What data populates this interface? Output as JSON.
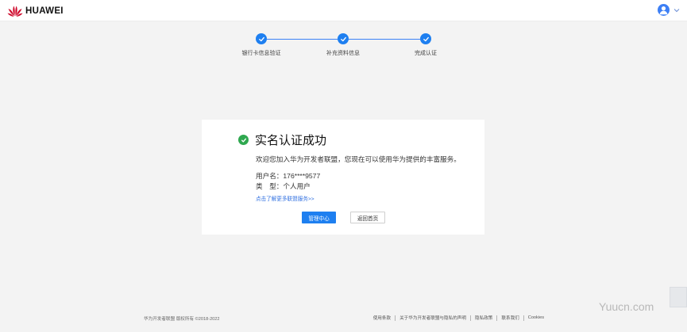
{
  "header": {
    "brand": "HUAWEI",
    "brand_color": "#cf0a2c",
    "avatar_icon": "user-avatar-icon",
    "dropdown_icon": "chevron-down-icon"
  },
  "steps": [
    {
      "label": "银行卡信息验证",
      "status": "done"
    },
    {
      "label": "补充资料信息",
      "status": "done"
    },
    {
      "label": "完成认证",
      "status": "done"
    }
  ],
  "result": {
    "title": "实名认证成功",
    "welcome": "欢迎您加入华为开发者联盟，您现在可以使用华为提供的丰富服务。",
    "username_label": "用户名：",
    "username_value": "176****9577",
    "type_label": "类　型：",
    "type_value": "个人用户",
    "more_link": "点击了解更多联盟服务>>",
    "primary_button": "管理中心",
    "secondary_button": "返回首页",
    "success_color": "#2fa84f",
    "accent_color": "#1e7ff0"
  },
  "footer": {
    "copyright": "华为开发者联盟 版权所有 ©2018-2022",
    "links": [
      "使用条款",
      "关于华为开发者联盟与隐私的声明",
      "隐私政策",
      "联系我们",
      "Cookies"
    ]
  },
  "watermark": "Yuucn.com"
}
